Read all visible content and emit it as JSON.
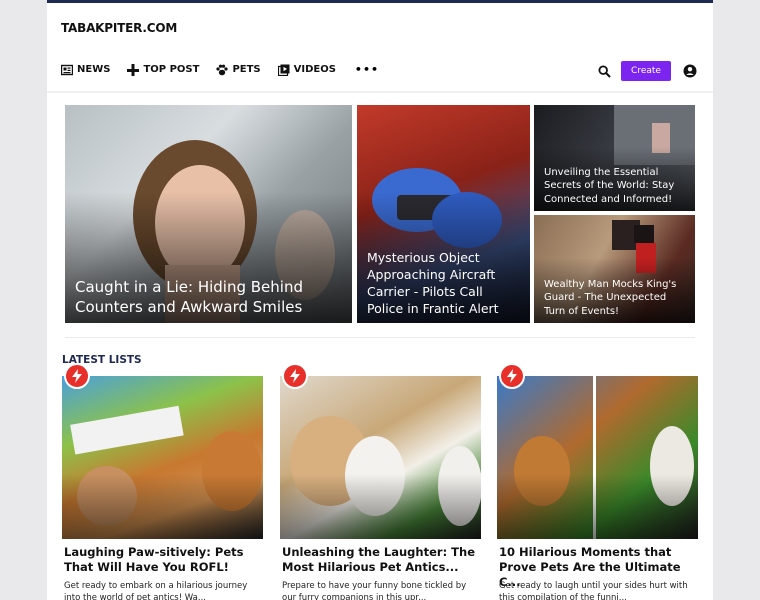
{
  "site": {
    "logo": "TABAKPITER.COM"
  },
  "nav": {
    "items": [
      {
        "label": "NEWS",
        "icon": "news-icon"
      },
      {
        "label": "TOP POST",
        "icon": "top-post-icon"
      },
      {
        "label": "PETS",
        "icon": "paw-icon"
      },
      {
        "label": "VIDEOS",
        "icon": "video-icon"
      }
    ],
    "more": "•••",
    "create_label": "Create"
  },
  "featured": [
    {
      "title": "Caught in a Lie: Hiding Behind Counters and Awkward Smiles"
    },
    {
      "title": "Mysterious Object Approaching Aircraft Carrier - Pilots Call Police in Frantic Alert"
    },
    {
      "title": "Unveiling the Essential Secrets of the World: Stay Connected and Informed!"
    },
    {
      "title": "Wealthy Man Mocks King's Guard - The Unexpected Turn of Events!"
    }
  ],
  "latest": {
    "heading": "LATEST LISTS",
    "cards": [
      {
        "title": "Laughing Paw-sitively: Pets That Will Have You ROFL!",
        "excerpt": "Get ready to embark on a hilarious journey into the world of pet antics! Wa..."
      },
      {
        "title": "Unleashing the Laughter: The Most Hilarious Pet Antics...",
        "excerpt": "Prepare to have your funny bone tickled by our furry companions in this upr..."
      },
      {
        "title": "10 Hilarious Moments that Prove Pets Are the Ultimate C...",
        "excerpt": "Get ready to laugh until your sides hurt with this compilation of the funni..."
      }
    ]
  },
  "colors": {
    "accent": "#7c25f0",
    "brand": "#1e2a52",
    "badge": "#e8302a"
  }
}
